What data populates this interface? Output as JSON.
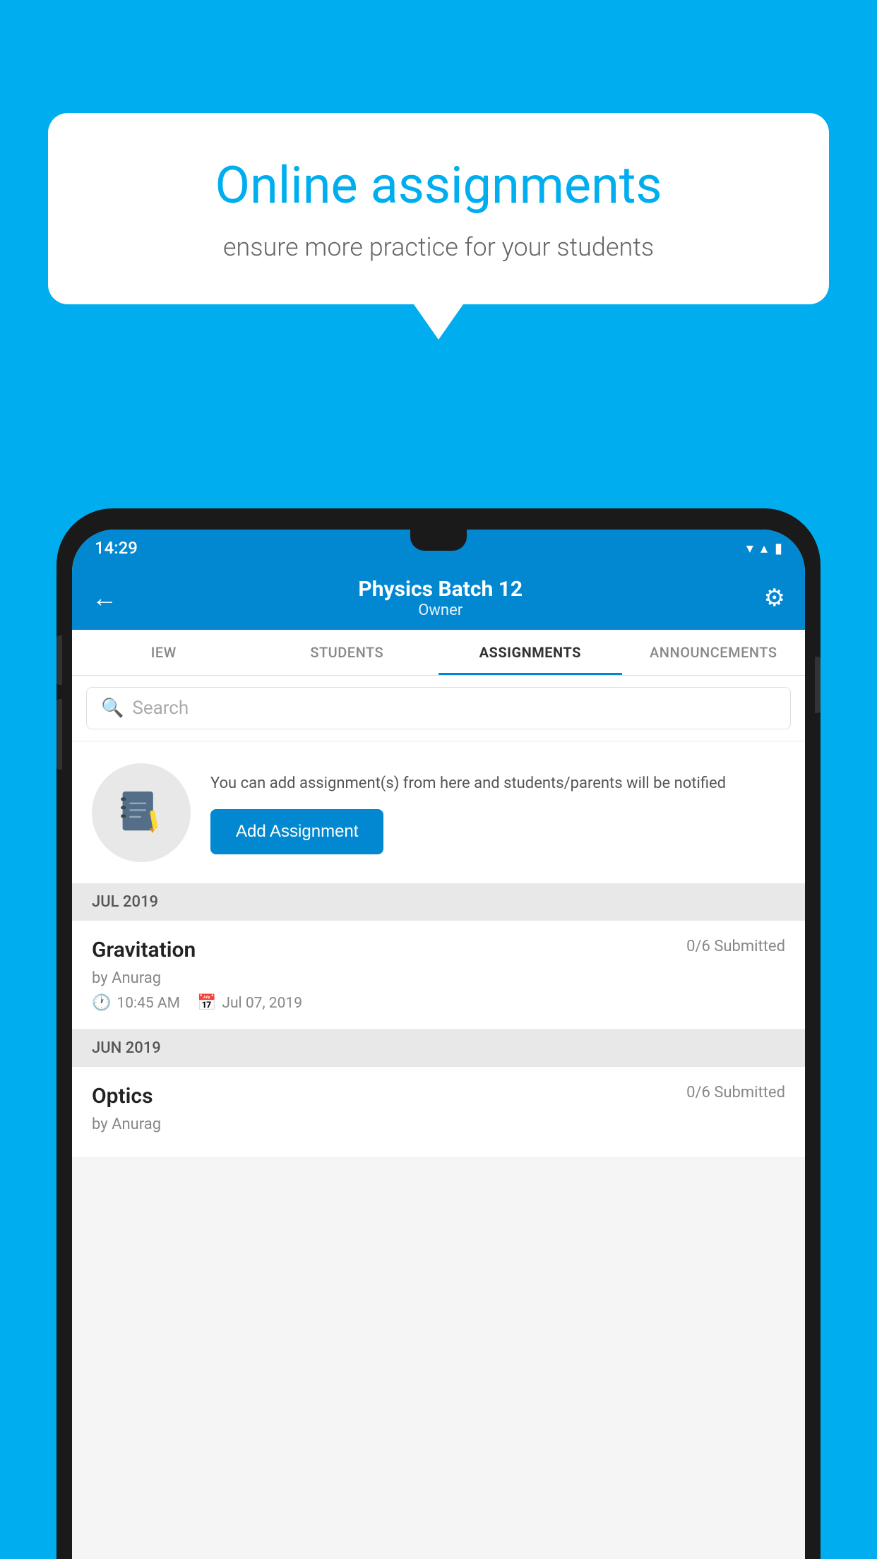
{
  "background_color": "#00AEEF",
  "speech_bubble": {
    "title": "Online assignments",
    "subtitle": "ensure more practice for your students"
  },
  "status_bar": {
    "time": "14:29",
    "wifi_icon": "▼",
    "signal_icon": "▲",
    "battery_icon": "▮"
  },
  "app_bar": {
    "title": "Physics Batch 12",
    "subtitle": "Owner",
    "back_label": "←",
    "settings_label": "⚙"
  },
  "tabs": [
    {
      "label": "IEW",
      "active": false
    },
    {
      "label": "STUDENTS",
      "active": false
    },
    {
      "label": "ASSIGNMENTS",
      "active": true
    },
    {
      "label": "ANNOUNCEMENTS",
      "active": false
    }
  ],
  "search": {
    "placeholder": "Search"
  },
  "promo": {
    "text": "You can add assignment(s) from here and students/parents will be notified",
    "button_label": "Add Assignment"
  },
  "sections": [
    {
      "header": "JUL 2019",
      "assignments": [
        {
          "name": "Gravitation",
          "submitted": "0/6 Submitted",
          "by": "by Anurag",
          "time": "10:45 AM",
          "date": "Jul 07, 2019"
        }
      ]
    },
    {
      "header": "JUN 2019",
      "assignments": [
        {
          "name": "Optics",
          "submitted": "0/6 Submitted",
          "by": "by Anurag",
          "time": "",
          "date": ""
        }
      ]
    }
  ]
}
